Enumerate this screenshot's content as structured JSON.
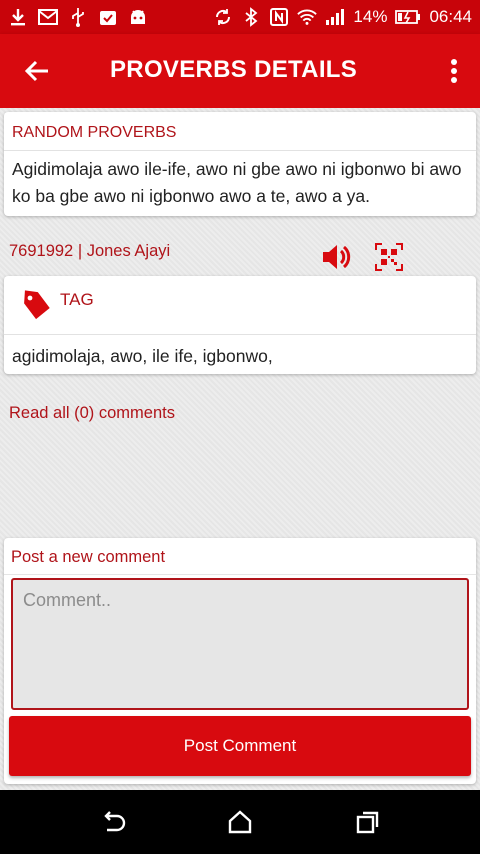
{
  "status_bar": {
    "battery_percent": "14%",
    "time": "06:44",
    "icons_left": [
      "download-icon",
      "gmail-icon",
      "usb-icon",
      "clipboard-check-icon",
      "android-icon"
    ],
    "icons_right": [
      "rotate-icon",
      "bluetooth-icon",
      "nfc-icon",
      "wifi-icon",
      "signal-icon",
      "battery-icon"
    ]
  },
  "app_bar": {
    "title": "PROVERBS DETAILS",
    "back_icon": "arrow-back-icon",
    "menu_icon": "more-vert-icon"
  },
  "proverb_card": {
    "header": "RANDOM PROVERBS",
    "text": "Agidimolaja awo ile-ife, awo ni gbe awo ni igbonwo bi awo ko ba gbe awo ni igbonwo awo a te, awo a ya."
  },
  "meta": {
    "id_author": "7691992 | Jones Ajayi",
    "speaker_icon": "speaker-icon",
    "qr_icon": "qr-code-icon"
  },
  "tag_card": {
    "title": "TAG",
    "tags": "agidimolaja, awo, ile ife, igbonwo,"
  },
  "comments": {
    "read_all": "Read all (0) comments",
    "post_header": "Post a new comment",
    "placeholder": "Comment..",
    "post_button": "Post Comment"
  },
  "colors": {
    "primary": "#d80a0f",
    "status_bar": "#c8040a",
    "accent_text": "#b0141a"
  }
}
